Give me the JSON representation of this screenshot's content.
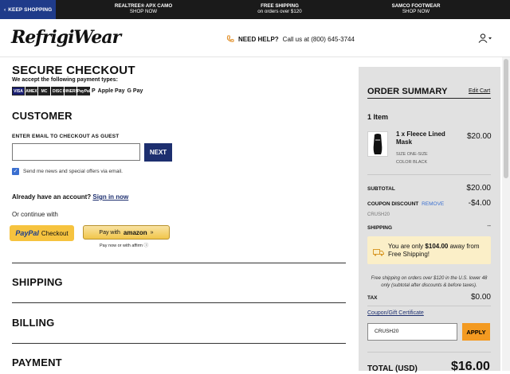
{
  "topbar": {
    "keep_shopping": "KEEP SHOPPING",
    "promos": [
      {
        "title": "REALTREE® APX CAMO",
        "sub": "SHOP NOW"
      },
      {
        "title": "FREE SHIPPING",
        "sub": "on orders over $120"
      },
      {
        "title": "SAMCO FOOTWEAR",
        "sub": "SHOP NOW"
      }
    ]
  },
  "header": {
    "logo": "RefrigiWear",
    "help_label": "NEED HELP?",
    "help_text": "Call us at (800) 645-3744"
  },
  "checkout": {
    "title": "SECURE CHECKOUT",
    "accept_text": "We accept the following payment types:",
    "payment_types": [
      "VISA",
      "AMEX",
      "MC",
      "DISC",
      "DINERS",
      "PayPal",
      "P",
      "Apple Pay",
      "G Pay"
    ],
    "customer_heading": "CUSTOMER",
    "email_label": "ENTER EMAIL TO CHECKOUT AS GUEST",
    "email_value": "",
    "next_label": "NEXT",
    "newsletter_text": "Send me news and special offers via email.",
    "already_text": "Already have an account?",
    "signin_text": "Sign in now",
    "continue_text": "Or continue with",
    "paypal_brand": "PayPal",
    "paypal_text": "Checkout",
    "amazon_text": "Pay with",
    "amazon_brand": "amazon",
    "paynow_text": "Pay now or with affirm",
    "sections": [
      "SHIPPING",
      "BILLING",
      "PAYMENT"
    ]
  },
  "summary": {
    "title": "ORDER SUMMARY",
    "edit_cart": "Edit Cart",
    "item_count": "1 Item",
    "product_name": "1 x Fleece Lined Mask",
    "product_price": "$20.00",
    "size": "SIZE ONE-SIZE",
    "color": "COLOR BLACK",
    "subtotal_label": "SUBTOTAL",
    "subtotal_value": "$20.00",
    "coupon_label": "COUPON DISCOUNT",
    "remove_label": "REMOVE",
    "coupon_value": "-$4.00",
    "coupon_code": "CRUSH20",
    "shipping_label": "SHIPPING",
    "shipping_value": "--",
    "shipping_msg_pre": "You are only",
    "shipping_msg_amount": "$104.00",
    "shipping_msg_post": "away from Free Shipping!",
    "shipping_note": "Free shipping on orders over $120 in the U.S. lower 48 only (subtotal after discounts & before taxes).",
    "tax_label": "TAX",
    "tax_value": "$0.00",
    "coupon_link": "Coupon/Gift Certificate",
    "coupon_input": "CRUSH20",
    "apply_label": "APPLY",
    "total_label": "TOTAL (USD)",
    "total_value": "$16.00"
  }
}
